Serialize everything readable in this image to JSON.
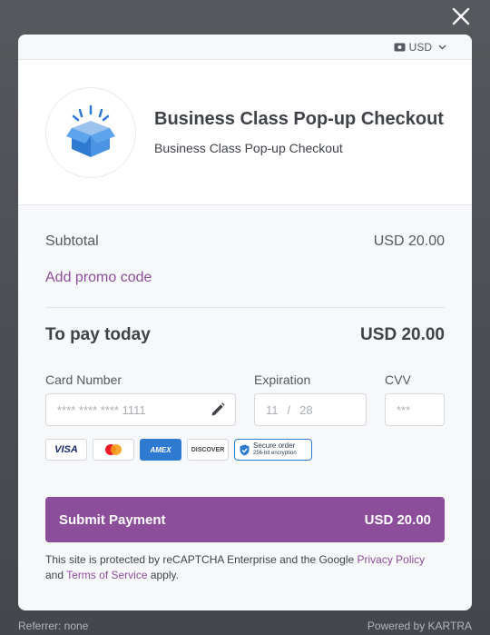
{
  "currency": {
    "label": "USD",
    "icon": "money-icon"
  },
  "product": {
    "title": "Business Class Pop-up Checkout",
    "subtitle": "Business Class Pop-up Checkout",
    "logo_icon": "open-box-icon"
  },
  "summary": {
    "subtotal_label": "Subtotal",
    "subtotal_value": "USD 20.00",
    "promo_label": "Add promo code",
    "total_label": "To pay today",
    "total_value": "USD 20.00"
  },
  "payment": {
    "card_label": "Card Number",
    "card_value": "**** **** **** 1111",
    "exp_label": "Expiration",
    "exp_month": "11",
    "exp_sep": "/",
    "exp_year": "28",
    "cvv_label": "CVV",
    "cvv_placeholder": "***"
  },
  "badges": {
    "visa": "VISA",
    "amex": "AMEX",
    "discover": "DISCOVER",
    "secure_title": "Secure order",
    "secure_sub": "256-bit encryption"
  },
  "submit": {
    "label": "Submit Payment",
    "amount": "USD 20.00"
  },
  "legal": {
    "text_before": "This site is protected by reCAPTCHA Enterprise and the Google ",
    "privacy_link": "Privacy Policy",
    "and": " and ",
    "terms_link": "Terms of Service",
    "text_after": " apply."
  },
  "footer": {
    "referrer": "Referrer: none",
    "powered": "Powered by KARTRA"
  },
  "colors": {
    "accent": "#8c4d9b",
    "backdrop": "#4d5054",
    "amex": "#2f7ad1"
  }
}
